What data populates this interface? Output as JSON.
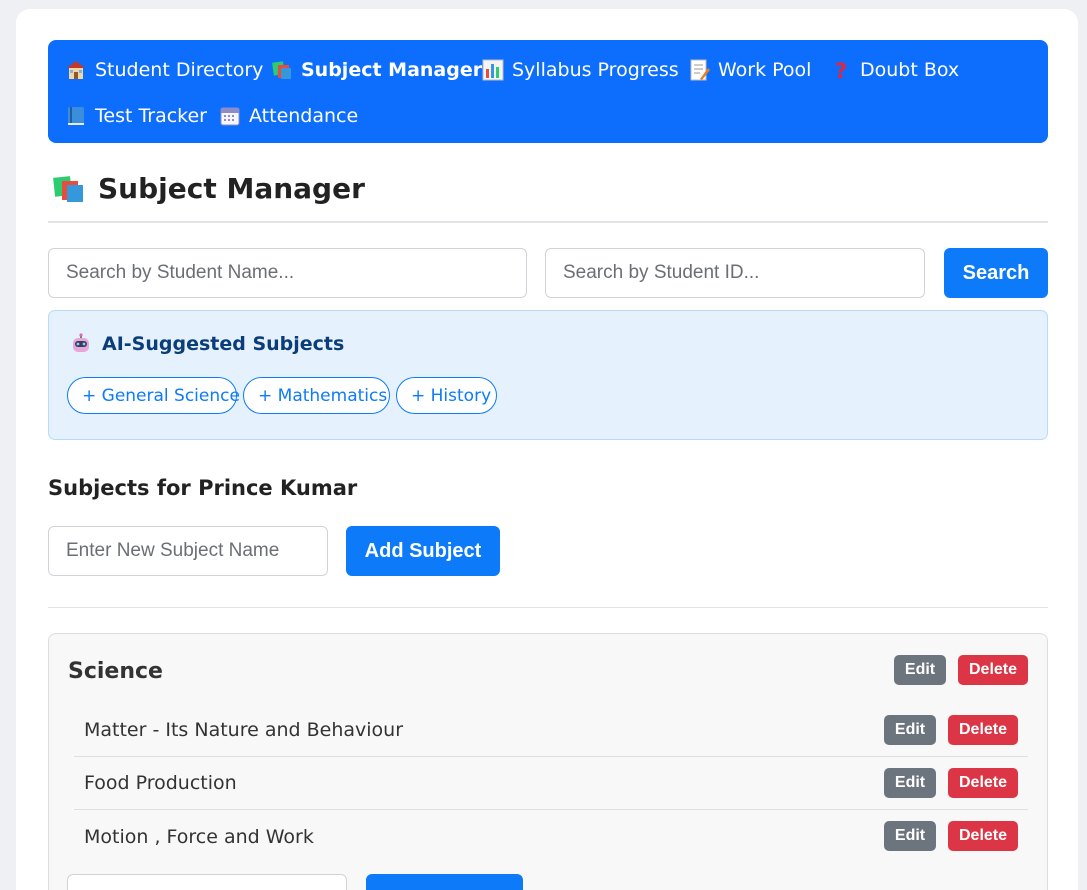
{
  "nav": {
    "items": [
      {
        "icon": "school-icon",
        "label": "Student Directory",
        "active": false
      },
      {
        "icon": "books-icon",
        "label": "Subject Manager",
        "active": true
      },
      {
        "icon": "bar-chart-icon",
        "label": "Syllabus Progress",
        "active": false
      },
      {
        "icon": "memo-icon",
        "label": "Work Pool",
        "active": false
      },
      {
        "icon": "question-icon",
        "label": "Doubt Box",
        "active": false
      },
      {
        "icon": "blue-book-icon",
        "label": "Test Tracker",
        "active": false
      },
      {
        "icon": "calendar-icon",
        "label": "Attendance",
        "active": false
      }
    ]
  },
  "page": {
    "title": "Subject Manager"
  },
  "search": {
    "name_placeholder": "Search by Student Name...",
    "id_placeholder": "Search by Student ID...",
    "button_label": "Search"
  },
  "ai": {
    "title": "AI-Suggested Subjects",
    "suggestions": [
      "+ General Science",
      "+ Mathematics",
      "+ History"
    ]
  },
  "subjects_section": {
    "heading": "Subjects for Prince Kumar",
    "new_subject_placeholder": "Enter New Subject Name",
    "add_button_label": "Add Subject"
  },
  "subjects": [
    {
      "name": "Science",
      "edit_label": "Edit",
      "delete_label": "Delete",
      "topics": [
        {
          "name": "Matter - Its Nature and Behaviour",
          "edit_label": "Edit",
          "delete_label": "Delete"
        },
        {
          "name": "Food Production",
          "edit_label": "Edit",
          "delete_label": "Delete"
        },
        {
          "name": "Motion , Force and Work",
          "edit_label": "Edit",
          "delete_label": "Delete"
        }
      ]
    }
  ],
  "colors": {
    "nav_bg": "#0d6efd",
    "primary": "#0d7bf9",
    "edit": "#6c757d",
    "delete": "#dc3545",
    "ai_panel_bg": "#e5f1fd"
  }
}
